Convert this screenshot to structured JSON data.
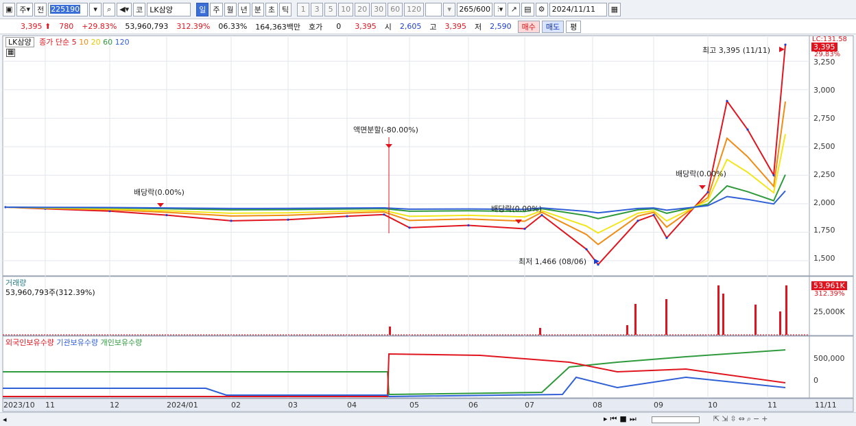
{
  "toolbar": {
    "period_main": "주",
    "prev_label": "전",
    "stock_code": "225190",
    "code_prefix": "코",
    "stock_name": "LK삼양",
    "tabs": [
      "일",
      "주",
      "월",
      "년",
      "분",
      "초",
      "틱"
    ],
    "active_tab": "일",
    "intervals": [
      "1",
      "3",
      "5",
      "10",
      "20",
      "30",
      "60",
      "120"
    ],
    "count": "265",
    "count_max": "/600",
    "date": "2024/11/11"
  },
  "quote": {
    "price": "3,395",
    "change": "780",
    "change_pct": "+29.83%",
    "volume": "53,960,793",
    "volume_pct": "312.39%",
    "turnover": "06.33%",
    "amount": "164,363백만",
    "hoga_label": "호가",
    "hoga_value": "0",
    "cur": "3,395",
    "open_label": "시",
    "open": "2,605",
    "high_label": "고",
    "high": "3,395",
    "low_label": "저",
    "low": "2,590",
    "buy_label": "매수",
    "sell_label": "매도",
    "eval_label": "평"
  },
  "price_legend": {
    "name": "LK삼양",
    "ma_label": "종가 단순",
    "periods": [
      "5",
      "10",
      "20",
      "60",
      "120"
    ],
    "colors": [
      "#e0141e",
      "#f08c14",
      "#f2e61b",
      "#2e9a3c",
      "#2f5fd6"
    ]
  },
  "price_axis": [
    "3,250",
    "3,000",
    "2,750",
    "2,500",
    "2,250",
    "2,000",
    "1,750",
    "1,500"
  ],
  "price_tags": {
    "top": "LC:131.58",
    "current": "3,395",
    "pct": "29.83%"
  },
  "annotations": {
    "high": "최고 3,395 (11/11)",
    "low": "최저 1,466 (08/06)",
    "split": "액면분할(-80.00%)",
    "div1": "배당락(0.00%)",
    "div2": "배당락(0.00%)",
    "div3": "배당락(0.00%)"
  },
  "volume_panel": {
    "title": "거래량",
    "value": "53,960,793주(312.39%)",
    "axis": "25,000K",
    "tag_value": "53,961K",
    "tag_pct": "312.39%"
  },
  "holdings_panel": {
    "series": [
      "외국인보유수량",
      "기관보유수량",
      "개인보유수량"
    ],
    "colors": [
      "#e0141e",
      "#2f5fd6",
      "#2e9a3c"
    ],
    "axis": [
      "500,000",
      "0"
    ]
  },
  "x_axis": [
    "2023/10",
    "11",
    "12",
    "2024/01",
    "02",
    "03",
    "04",
    "05",
    "06",
    "07",
    "08",
    "09",
    "10",
    "11",
    "11/11"
  ],
  "chart_data": {
    "type": "candlestick",
    "xlabel": "",
    "ylabel": "",
    "ylim": [
      1380,
      3450
    ],
    "close_points": [
      [
        "2023/10",
        1970
      ],
      [
        "11",
        1955
      ],
      [
        "12",
        1935
      ],
      [
        "2024/01",
        1900
      ],
      [
        "02",
        1850
      ],
      [
        "03",
        1860
      ],
      [
        "04",
        1890
      ],
      [
        "04-25",
        1905
      ],
      [
        "05",
        1790
      ],
      [
        "06",
        1810
      ],
      [
        "07",
        1780
      ],
      [
        "07-15",
        1900
      ],
      [
        "08",
        1600
      ],
      [
        "08-06",
        1466
      ],
      [
        "08-20",
        1850
      ],
      [
        "09",
        1900
      ],
      [
        "09-15",
        1700
      ],
      [
        "10",
        2100
      ],
      [
        "10-10",
        2900
      ],
      [
        "10-20",
        2650
      ],
      [
        "11",
        2250
      ],
      [
        "11/11",
        3395
      ]
    ]
  }
}
